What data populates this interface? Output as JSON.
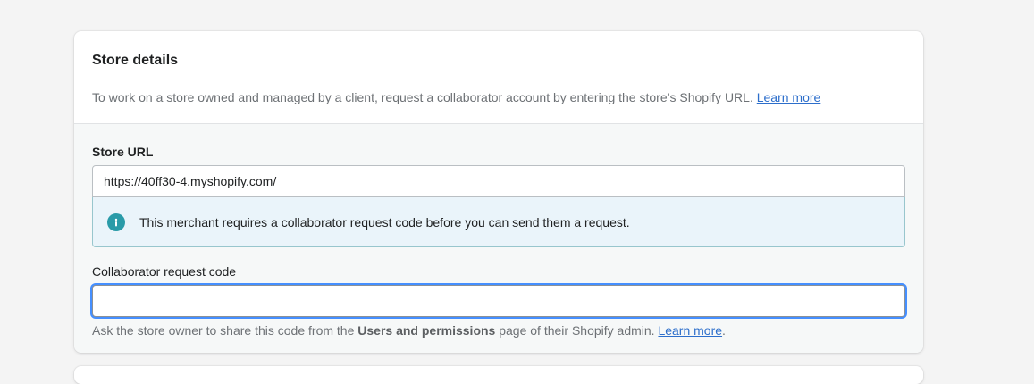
{
  "store_details": {
    "title": "Store details",
    "description": "To work on a store owned and managed by a client, request a collaborator account by entering the store’s Shopify URL.",
    "learn_more": "Learn more"
  },
  "store_url": {
    "label": "Store URL",
    "value": "https://40ff30-4.myshopify.com/"
  },
  "banner": {
    "icon": "info-icon",
    "text": "This merchant requires a collaborator request code before you can send them a request."
  },
  "request_code": {
    "label": "Collaborator request code",
    "value": "",
    "help_prefix": "Ask the store owner to share this code from the",
    "help_strong": "Users and permissions",
    "help_suffix": "page of their Shopify admin.",
    "learn_more": "Learn more",
    "period": "."
  },
  "colors": {
    "link": "#2c6ecb",
    "info_icon": "#2a9ba8",
    "banner_bg": "#eaf4fa",
    "focus_ring": "#458fff"
  }
}
